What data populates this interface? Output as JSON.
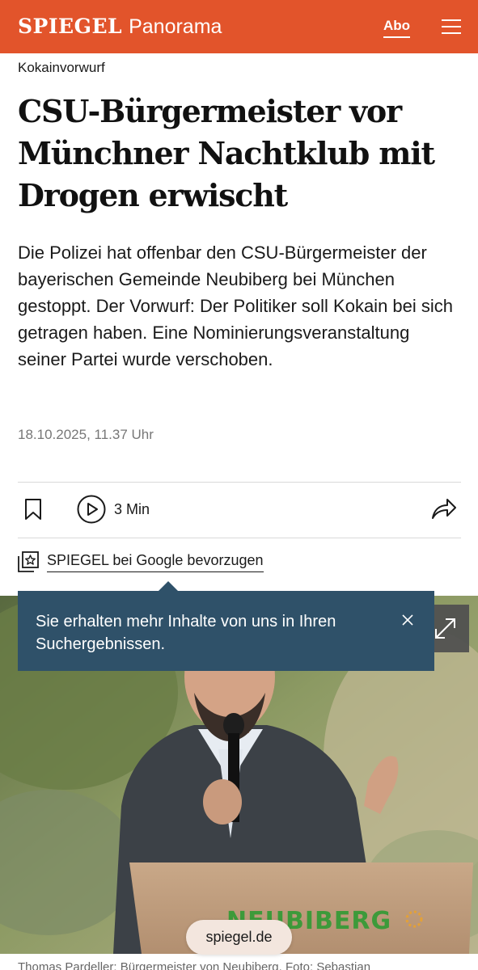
{
  "header": {
    "logo": "SPIEGEL",
    "section": "Panorama",
    "abo_label": "Abo",
    "menu_icon": "hamburger-menu-icon",
    "background": "#e2542b"
  },
  "article": {
    "kicker": "Kokainvorwurf",
    "headline": "CSU-Bürgermeister vor Münchner Nachtklub mit Drogen erwischt",
    "teaser": "Die Polizei hat offenbar den CSU-Bürgermeister der bayerischen Gemeinde Neubiberg bei München gestoppt. Der Vorwurf: Der Politiker soll Kokain bei sich getragen haben. Eine Nominierungsveranstaltung seiner Partei wurde verschoben.",
    "date": "18.10.2025, 11.37 Uhr"
  },
  "actions": {
    "bookmark_icon": "bookmark-icon",
    "listen_icon": "play-circle-icon",
    "listen_label": "3 Min",
    "share_icon": "share-arrow-icon"
  },
  "google_pref": {
    "icon": "star-stack-icon",
    "label": "SPIEGEL bei Google bevorzugen"
  },
  "tooltip": {
    "text": "Sie erhalten mehr Inhalte von uns in Ihren Suchergebnissen.",
    "close_icon": "close-icon",
    "background": "#2f5169"
  },
  "hero": {
    "lectern_text": "NEUBIBERG",
    "expand_icon": "expand-icon"
  },
  "url_bar": {
    "domain": "spiegel.de"
  },
  "caption": {
    "text": "Thomas Pardeller: Bürgermeister von Neubiberg. Foto: Sebastian"
  }
}
